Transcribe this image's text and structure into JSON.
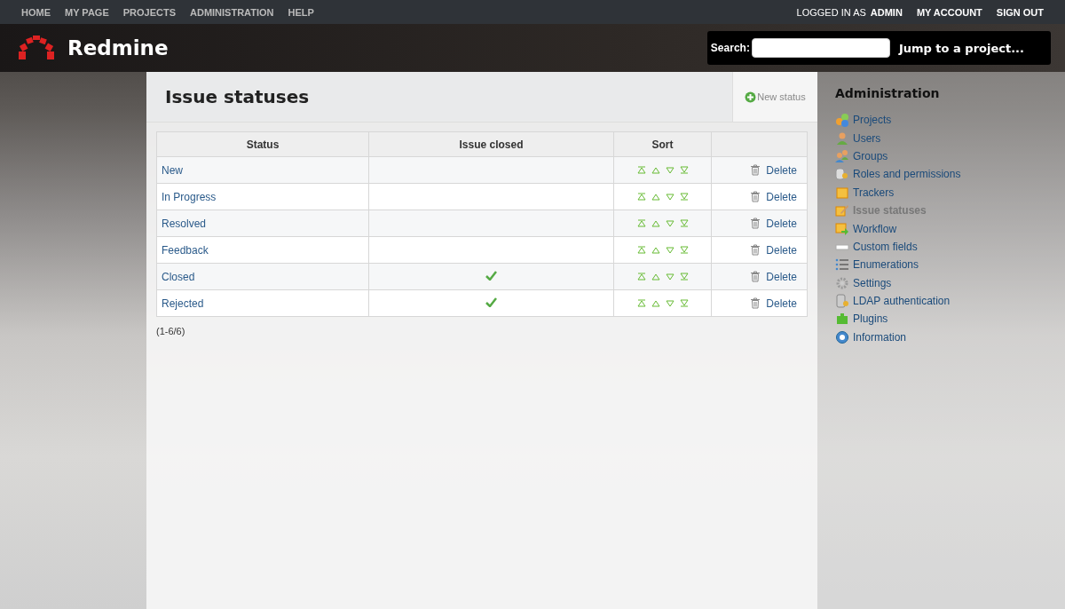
{
  "top_menu": {
    "items": [
      "HOME",
      "MY PAGE",
      "PROJECTS",
      "ADMINISTRATION",
      "HELP"
    ],
    "logged_in_label": "LOGGED IN AS",
    "user": "ADMIN",
    "account_items": [
      "MY ACCOUNT",
      "SIGN OUT"
    ]
  },
  "header": {
    "title": "Redmine",
    "search_label": "Search:",
    "jump": "Jump to a project..."
  },
  "content": {
    "title": "Issue statuses",
    "new_button": "New status",
    "table": {
      "columns": [
        "Status",
        "Issue closed",
        "Sort",
        ""
      ],
      "rows": [
        {
          "name": "New",
          "closed": false,
          "delete": "Delete"
        },
        {
          "name": "In Progress",
          "closed": false,
          "delete": "Delete"
        },
        {
          "name": "Resolved",
          "closed": false,
          "delete": "Delete"
        },
        {
          "name": "Feedback",
          "closed": false,
          "delete": "Delete"
        },
        {
          "name": "Closed",
          "closed": true,
          "delete": "Delete"
        },
        {
          "name": "Rejected",
          "closed": true,
          "delete": "Delete"
        }
      ]
    },
    "pagination": "(1-6/6)"
  },
  "sidebar": {
    "title": "Administration",
    "items": [
      {
        "label": "Projects",
        "selected": false
      },
      {
        "label": "Users",
        "selected": false
      },
      {
        "label": "Groups",
        "selected": false
      },
      {
        "label": "Roles and permissions",
        "selected": false
      },
      {
        "label": "Trackers",
        "selected": false
      },
      {
        "label": "Issue statuses",
        "selected": true
      },
      {
        "label": "Workflow",
        "selected": false
      },
      {
        "label": "Custom fields",
        "selected": false
      },
      {
        "label": "Enumerations",
        "selected": false
      },
      {
        "label": "Settings",
        "selected": false
      },
      {
        "label": "LDAP authentication",
        "selected": false
      },
      {
        "label": "Plugins",
        "selected": false
      },
      {
        "label": "Information",
        "selected": false
      }
    ]
  }
}
